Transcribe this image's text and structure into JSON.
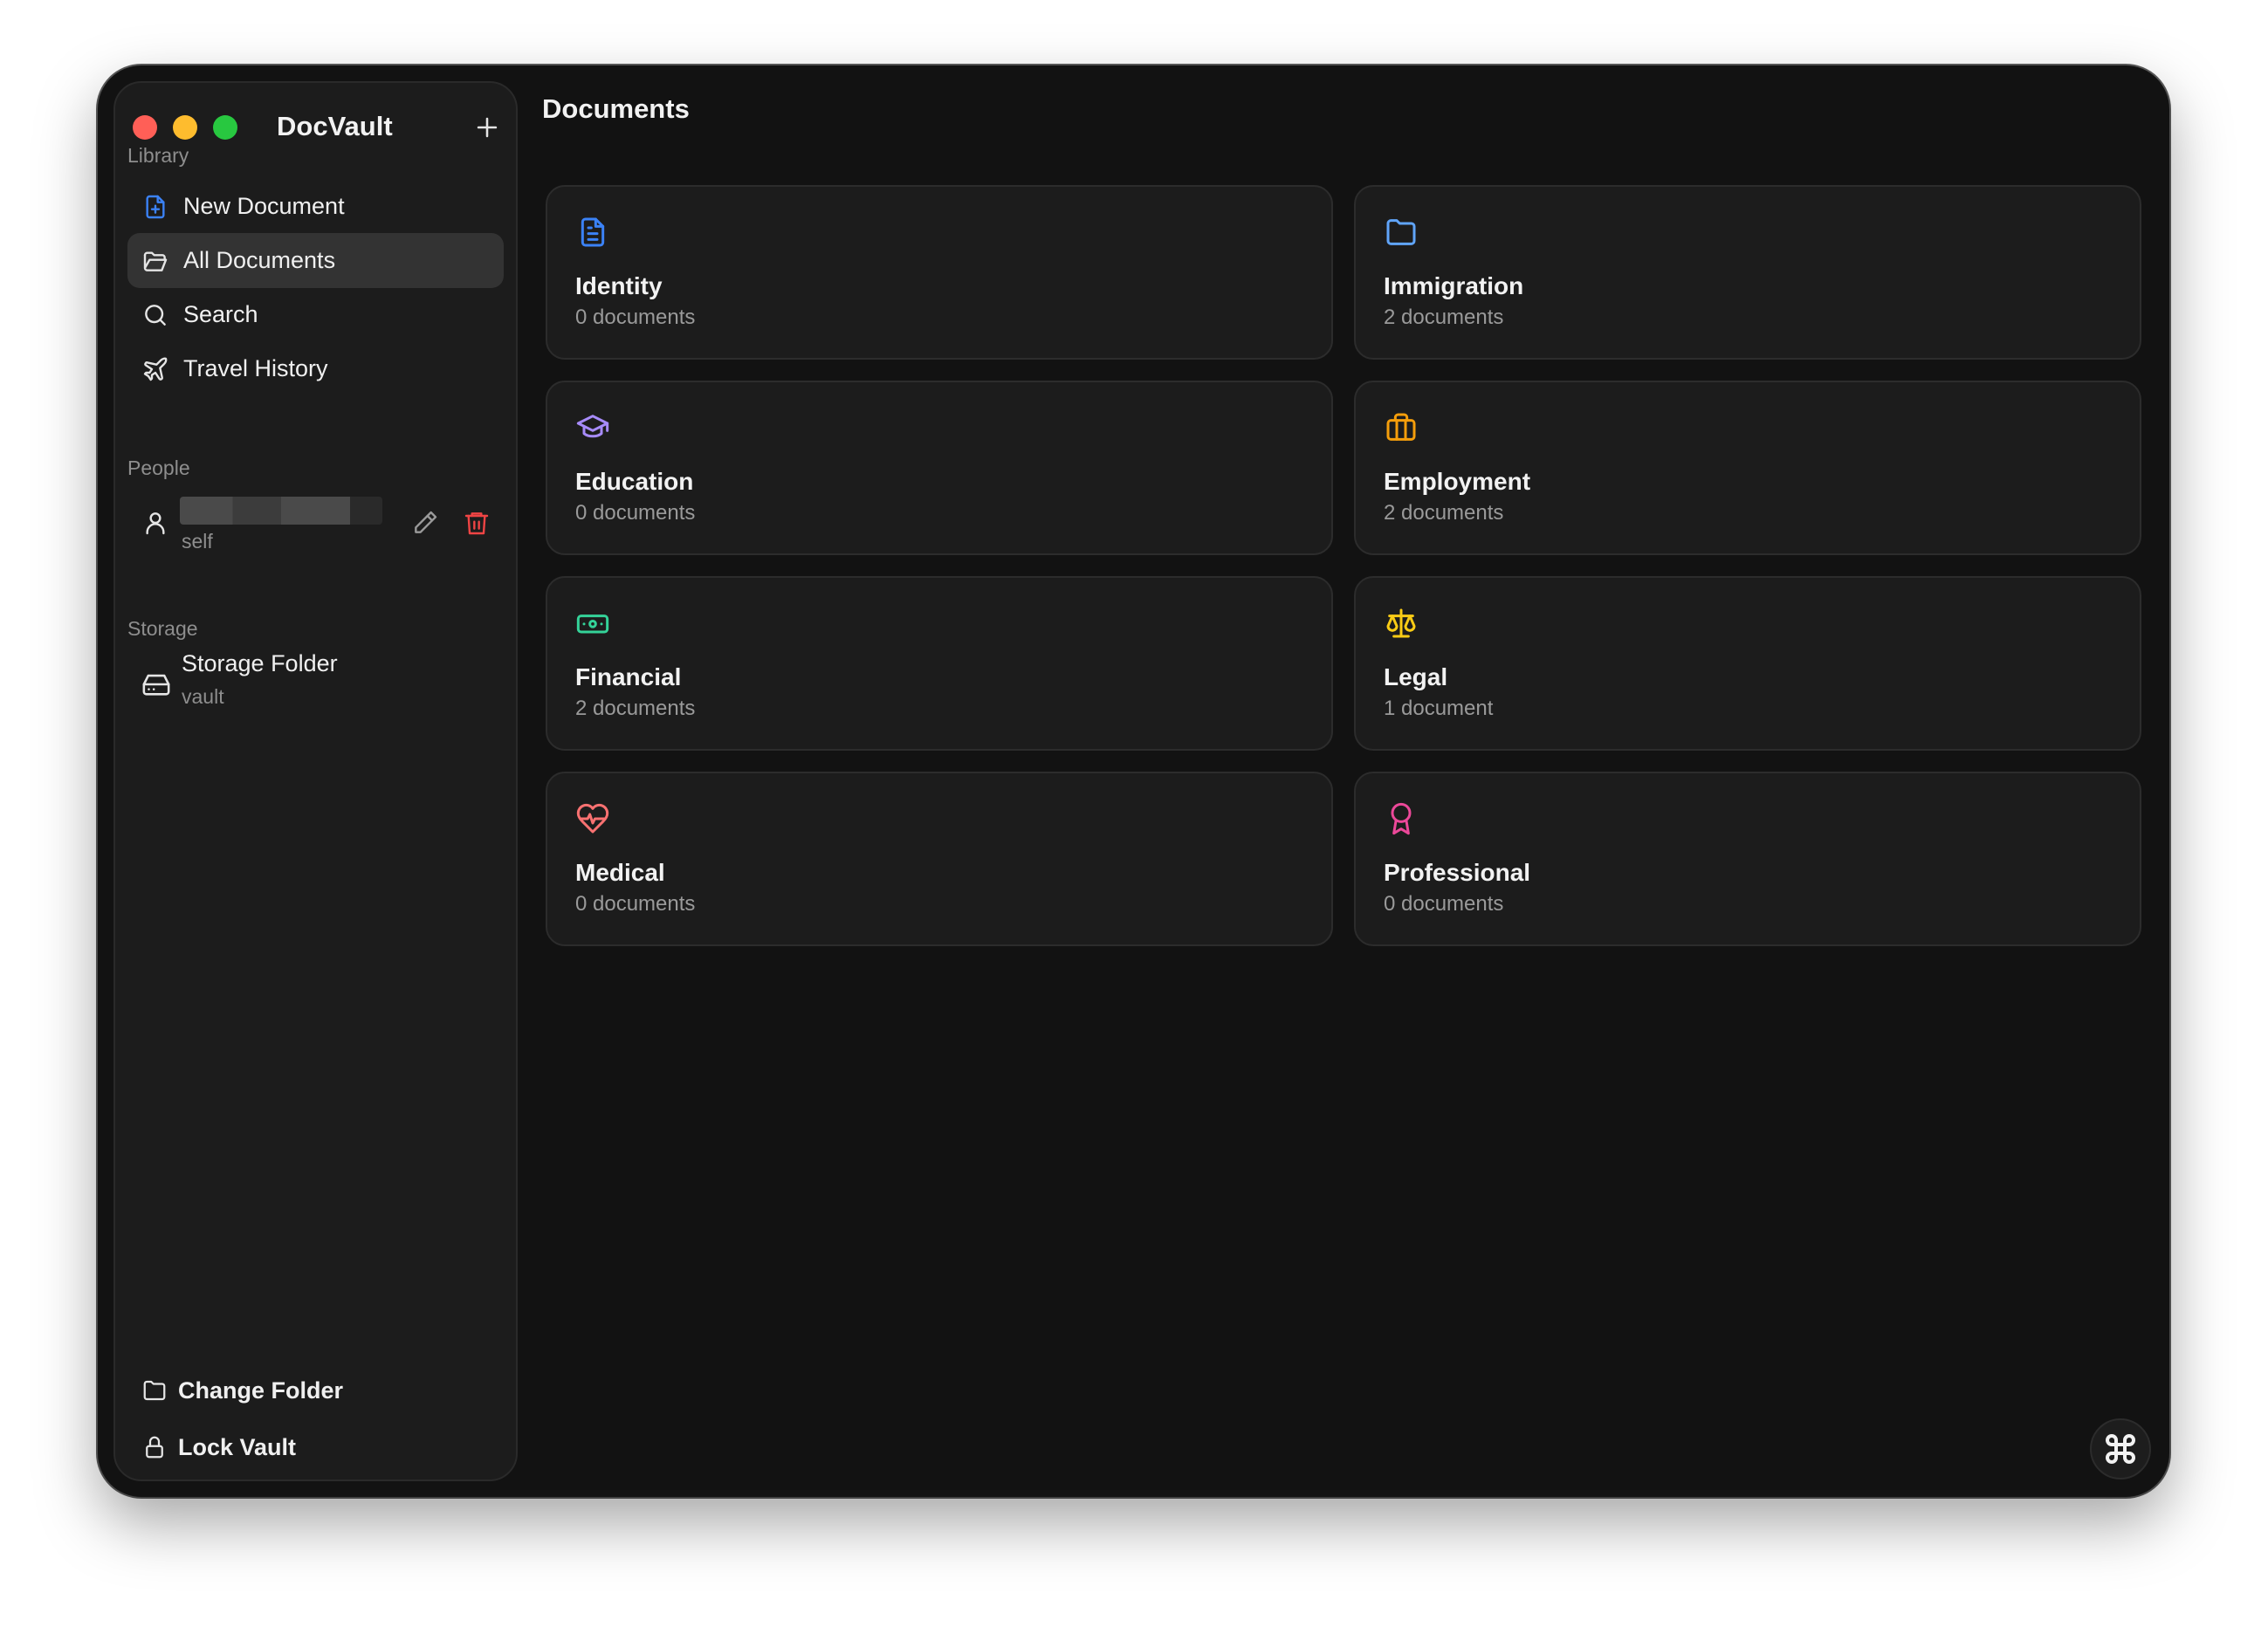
{
  "app": {
    "title": "DocVault"
  },
  "sidebar": {
    "library_label": "Library",
    "nav": [
      {
        "label": "New Document",
        "icon": "file-plus-icon"
      },
      {
        "label": "All Documents",
        "icon": "folder-open-icon",
        "active": true
      },
      {
        "label": "Search",
        "icon": "search-icon"
      },
      {
        "label": "Travel History",
        "icon": "plane-icon"
      }
    ],
    "people_label": "People",
    "person": {
      "role": "self"
    },
    "storage_label": "Storage",
    "storage": {
      "title": "Storage Folder",
      "subtitle": "vault"
    },
    "change_folder": "Change Folder",
    "lock_vault": "Lock Vault"
  },
  "main": {
    "title": "Documents",
    "categories": [
      {
        "name": "Identity",
        "count": "0 documents",
        "icon": "file-text-icon",
        "color": "#3b82f6"
      },
      {
        "name": "Immigration",
        "count": "2 documents",
        "icon": "folder-icon",
        "color": "#60a5fa"
      },
      {
        "name": "Education",
        "count": "0 documents",
        "icon": "graduation-cap-icon",
        "color": "#a78bfa"
      },
      {
        "name": "Employment",
        "count": "2 documents",
        "icon": "briefcase-icon",
        "color": "#f59e0b"
      },
      {
        "name": "Financial",
        "count": "2 documents",
        "icon": "banknote-icon",
        "color": "#34d399"
      },
      {
        "name": "Legal",
        "count": "1 document",
        "icon": "scale-icon",
        "color": "#facc15"
      },
      {
        "name": "Medical",
        "count": "0 documents",
        "icon": "heart-pulse-icon",
        "color": "#f87171"
      },
      {
        "name": "Professional",
        "count": "0 documents",
        "icon": "award-icon",
        "color": "#ec4899"
      }
    ]
  }
}
